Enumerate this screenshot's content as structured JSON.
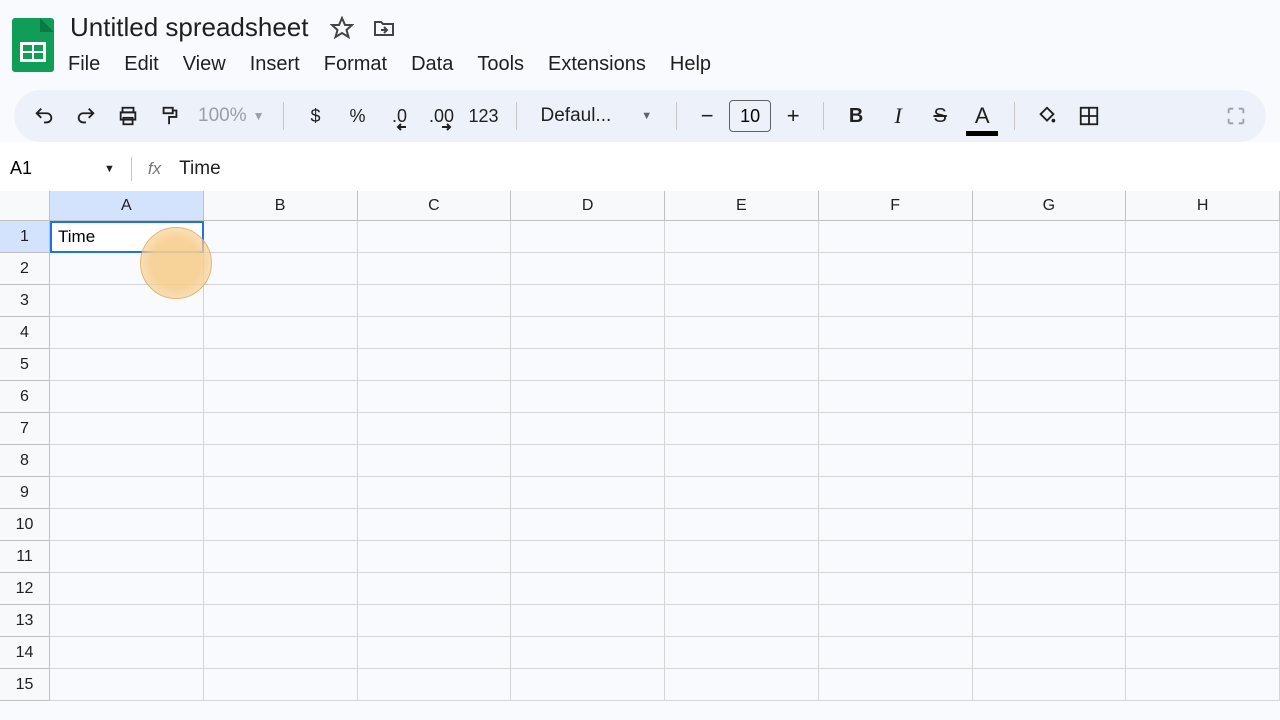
{
  "doc": {
    "title": "Untitled spreadsheet"
  },
  "menu": [
    "File",
    "Edit",
    "View",
    "Insert",
    "Format",
    "Data",
    "Tools",
    "Extensions",
    "Help"
  ],
  "toolbar": {
    "zoom": "100%",
    "currency": "$",
    "percent": "%",
    "dec_decrease": ".0",
    "dec_increase": ".00",
    "numfmt": "123",
    "font": "Defaul...",
    "font_size": "10",
    "bold": "B",
    "italic": "I",
    "strike": "S",
    "text_color": "A"
  },
  "namebox": {
    "cell": "A1",
    "fx": "fx",
    "formula": "Time"
  },
  "columns": [
    "A",
    "B",
    "C",
    "D",
    "E",
    "F",
    "G",
    "H"
  ],
  "rows": [
    "1",
    "2",
    "3",
    "4",
    "5",
    "6",
    "7",
    "8",
    "9",
    "10",
    "11",
    "12",
    "13",
    "14",
    "15"
  ],
  "cells": {
    "A1": "Time"
  },
  "active": "A1"
}
